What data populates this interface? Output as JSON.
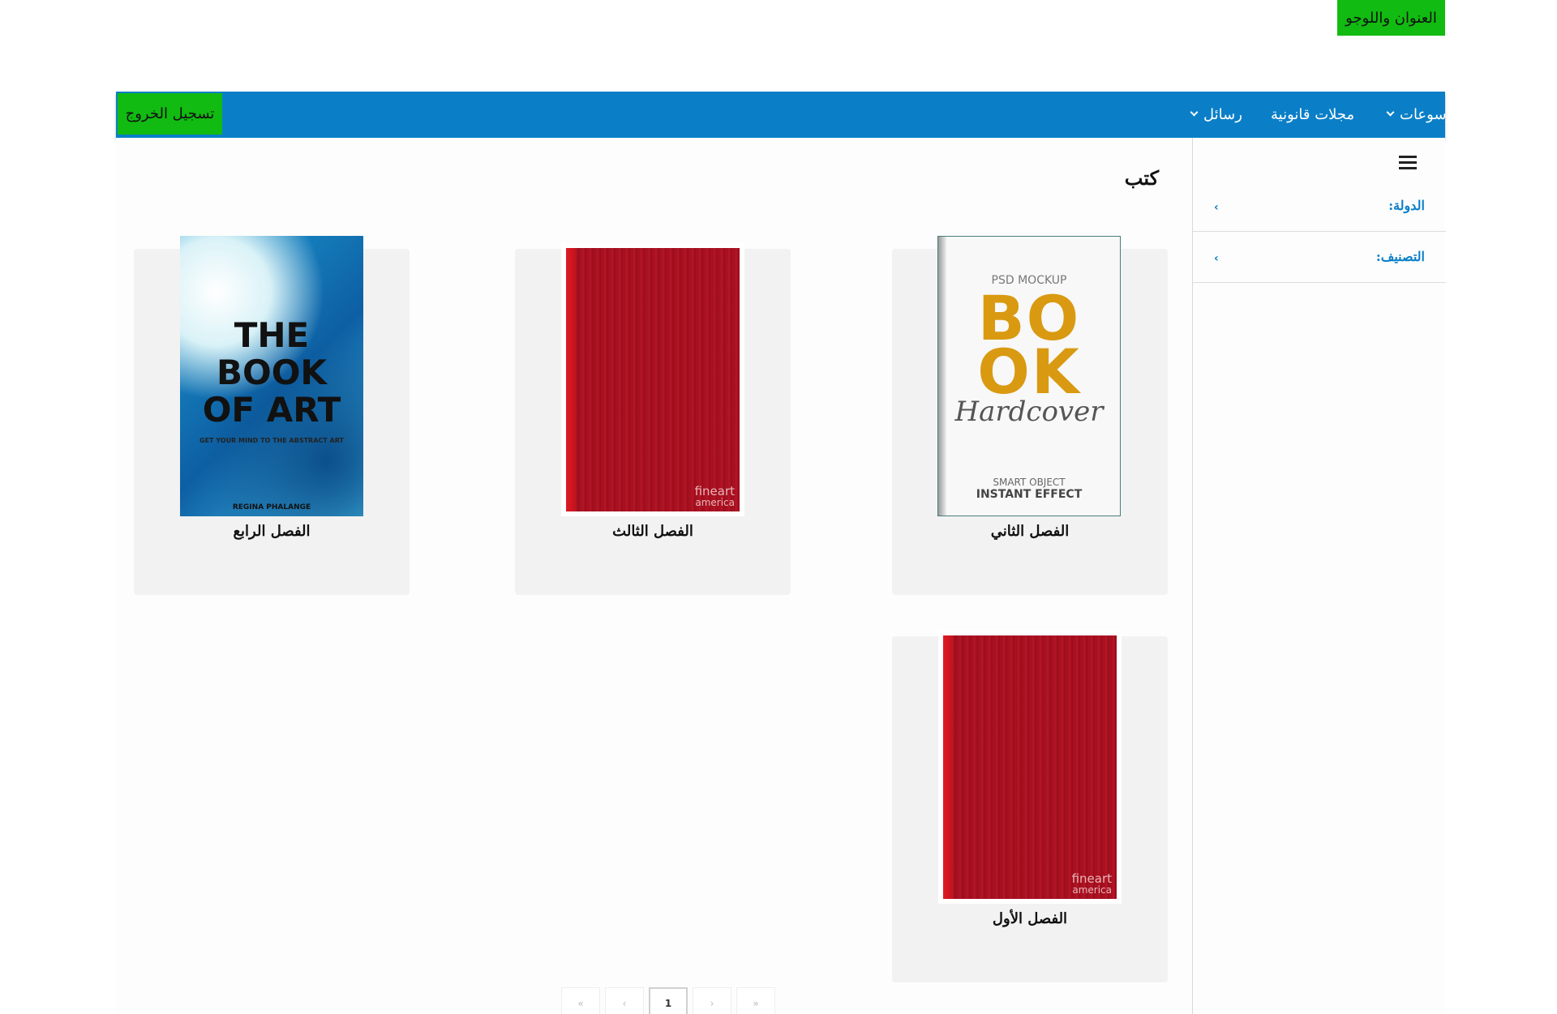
{
  "header": {
    "logo_text": "العنوان واللوجو"
  },
  "nav": {
    "logout_label": "تسجيل الخروج",
    "items": [
      {
        "label": "كتب قانونية و موسوعات",
        "has_dropdown": true
      },
      {
        "label": "مجلات قانونية",
        "has_dropdown": false
      },
      {
        "label": "رسائل",
        "has_dropdown": true
      }
    ],
    "colors": {
      "bar": "#0a7fc8",
      "accent_green": "#11bb11"
    }
  },
  "sidebar": {
    "menu_icon": "hamburger-icon",
    "filters": [
      {
        "label": "الدولة:",
        "icon": "chevron-icon"
      },
      {
        "label": "التصنيف:",
        "icon": "chevron-icon"
      }
    ]
  },
  "main": {
    "title": "كتب",
    "books": [
      {
        "title": "الفصل الثاني",
        "cover": {
          "style": "mockup",
          "psd": "PSD MOCKUP",
          "big": "BO OK",
          "script": "Hardcover",
          "smart": "SMART OBJECT",
          "instant": "INSTANT EFFECT"
        }
      },
      {
        "title": "الفصل الثالث",
        "cover": {
          "style": "red",
          "brand": "fineart",
          "brand_sub": "america"
        }
      },
      {
        "title": "الفصل الرابع",
        "cover": {
          "style": "art",
          "title": "THE BOOK OF ART",
          "subtitle": "GET YOUR MIND TO THE ABSTRACT ART",
          "author": "REGINA PHALANGE"
        }
      },
      {
        "title": "الفصل الأول",
        "cover": {
          "style": "red",
          "brand": "fineart",
          "brand_sub": "america"
        }
      }
    ]
  },
  "pagination": {
    "buttons": [
      "«",
      "‹",
      "1",
      "›",
      "»"
    ],
    "current": "1"
  }
}
